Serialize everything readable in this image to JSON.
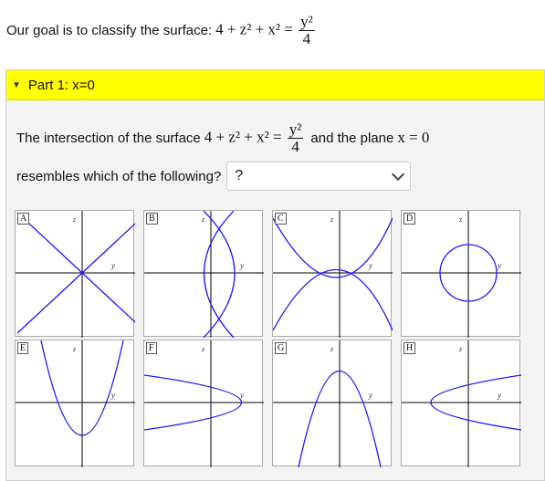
{
  "goal": {
    "text": "Our goal is to classify the surface:",
    "eq_left": "4 + z² + x² =",
    "eq_num": "y²",
    "eq_den": "4"
  },
  "part": {
    "header": "Part 1: x=0",
    "caret": "▼",
    "q_pre": "The intersection of the surface",
    "q_eq_left": "4 + z² + x² =",
    "q_eq_num": "y²",
    "q_eq_den": "4",
    "q_mid": "and the plane",
    "q_plane": "x = 0",
    "q_line2": "resembles which of the following?",
    "select_value": "?"
  },
  "options": [
    {
      "letter": "A",
      "curve": "crossing-lines",
      "xlabel": "y",
      "ylabel": "z"
    },
    {
      "letter": "B",
      "curve": "hyperbola-horizontal",
      "xlabel": "y",
      "ylabel": "z"
    },
    {
      "letter": "C",
      "curve": "hyperbola-vertical",
      "xlabel": "y",
      "ylabel": "z"
    },
    {
      "letter": "D",
      "curve": "circle",
      "xlabel": "y",
      "ylabel": "z"
    },
    {
      "letter": "E",
      "curve": "parabola-up",
      "xlabel": "y",
      "ylabel": "z"
    },
    {
      "letter": "F",
      "curve": "parabola-left",
      "xlabel": "y",
      "ylabel": "z"
    },
    {
      "letter": "G",
      "curve": "parabola-down",
      "xlabel": "y",
      "ylabel": "z"
    },
    {
      "letter": "H",
      "curve": "parabola-right",
      "xlabel": "y",
      "ylabel": "z"
    }
  ],
  "colors": {
    "curve": "#1a1aff",
    "axis": "#000000",
    "header": "#ffff00",
    "panel": "#f3f3f3"
  }
}
